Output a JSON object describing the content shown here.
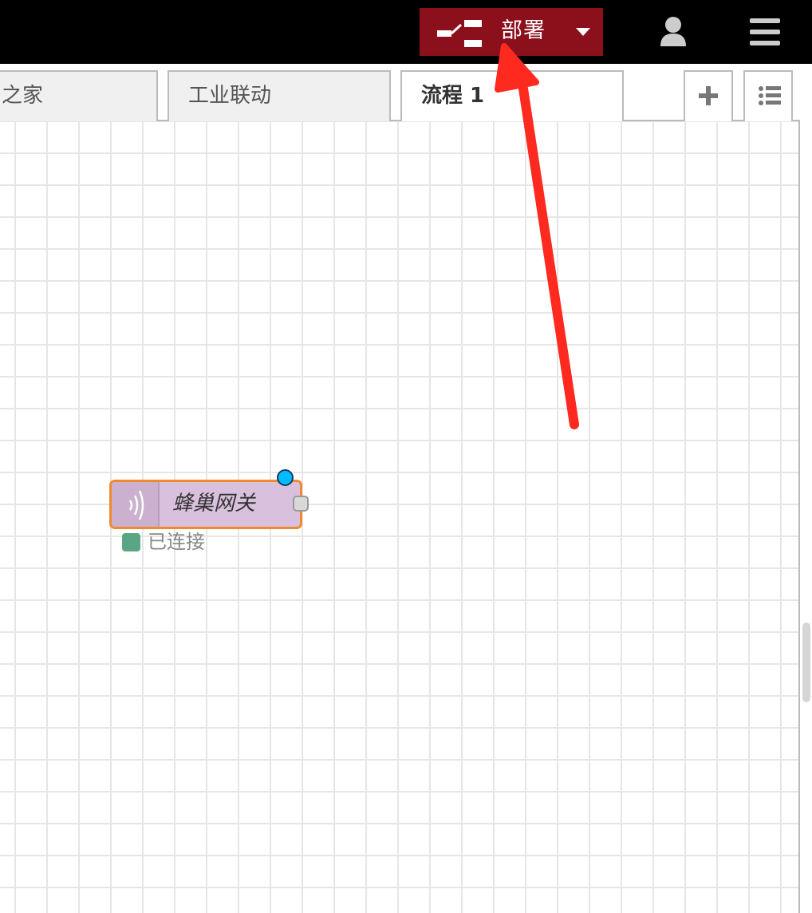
{
  "header": {
    "deploy_label": "部署",
    "deploy_color": "#8c101c",
    "icons": [
      "deploy-icon",
      "caret-down-icon",
      "user-icon",
      "hamburger-menu-icon"
    ]
  },
  "tabs": [
    {
      "label": "之家",
      "active": false
    },
    {
      "label": "工业联动",
      "active": false
    },
    {
      "label": "流程 1",
      "active": true
    }
  ],
  "tab_buttons": {
    "add_icon": "plus-icon",
    "list_icon": "list-icon"
  },
  "node": {
    "label": "蜂巢网关",
    "icon": "wireless-signal-icon",
    "status_text": "已连接",
    "status_color": "#5aa684",
    "border_color": "#f08a2c",
    "changed_indicator_color": "#00bcff"
  },
  "annotation": {
    "type": "red-arrow",
    "color": "#ff2a1f",
    "points_to": "deploy-button"
  }
}
